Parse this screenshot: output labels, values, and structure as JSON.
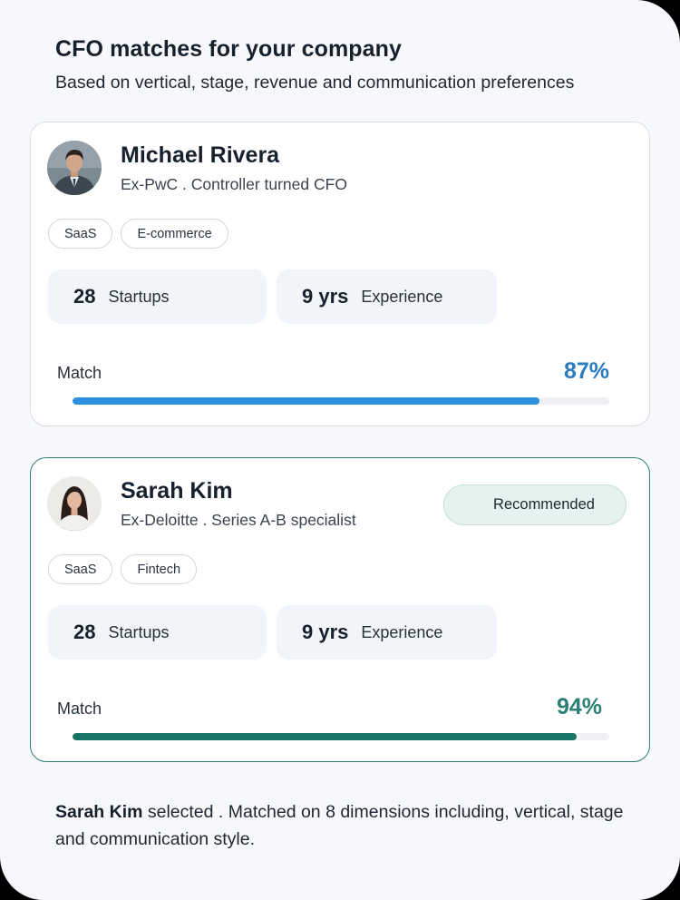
{
  "header": {
    "title": "CFO matches for your company",
    "subtitle": "Based on vertical, stage, revenue and communication preferences"
  },
  "candidates": [
    {
      "name": "Michael Rivera",
      "role": "Ex-PwC . Controller turned CFO",
      "tags": [
        "SaaS",
        "E-commerce"
      ],
      "stats": [
        {
          "value": "28",
          "label": "Startups"
        },
        {
          "value": "9 yrs",
          "label": "Experience"
        }
      ],
      "match_label": "Match",
      "match_text": "87%",
      "match_value": 0.87,
      "bar_color": "#2d8fe0",
      "avatar": "person-photo"
    },
    {
      "name": "Sarah Kim",
      "role": "Ex-Deloitte . Series A-B specialist",
      "badge": "Recommended",
      "tags": [
        "SaaS",
        "Fintech"
      ],
      "stats": [
        {
          "value": "28",
          "label": "Startups"
        },
        {
          "value": "9 yrs",
          "label": "Experience"
        }
      ],
      "match_label": "Match",
      "match_text": "94%",
      "match_value": 0.94,
      "bar_color": "#1b7566",
      "avatar": "person-photo"
    }
  ],
  "footer": {
    "name": "Sarah Kim",
    "text": " selected . Matched on 8 dimensions including, vertical, stage and communication style."
  }
}
